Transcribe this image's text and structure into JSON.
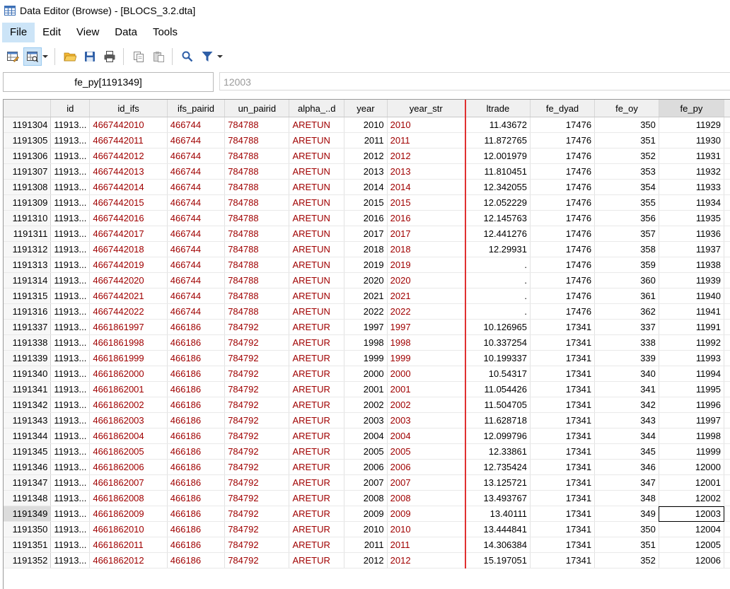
{
  "window": {
    "title": "Data Editor (Browse) - [BLOCS_3.2.dta]"
  },
  "menu": {
    "file": "File",
    "edit": "Edit",
    "view": "View",
    "data": "Data",
    "tools": "Tools"
  },
  "varbar": {
    "name": "fe_py[1191349]",
    "value": "12003"
  },
  "columns": [
    "id",
    "id_ifs",
    "ifs_pairid",
    "un_pairid",
    "alpha_..d",
    "year",
    "year_str",
    "ltrade",
    "fe_dyad",
    "fe_oy",
    "fe_py"
  ],
  "rows": [
    {
      "n": "1191304",
      "id": "11913...",
      "id_ifs": "4667442010",
      "ifs_pairid": "466744",
      "un_pairid": "784788",
      "alpha": "ARETUN",
      "year": "2010",
      "year_str": "2010",
      "ltrade": "11.43672",
      "fe_dyad": "17476",
      "fe_oy": "350",
      "fe_py": "11929"
    },
    {
      "n": "1191305",
      "id": "11913...",
      "id_ifs": "4667442011",
      "ifs_pairid": "466744",
      "un_pairid": "784788",
      "alpha": "ARETUN",
      "year": "2011",
      "year_str": "2011",
      "ltrade": "11.872765",
      "fe_dyad": "17476",
      "fe_oy": "351",
      "fe_py": "11930"
    },
    {
      "n": "1191306",
      "id": "11913...",
      "id_ifs": "4667442012",
      "ifs_pairid": "466744",
      "un_pairid": "784788",
      "alpha": "ARETUN",
      "year": "2012",
      "year_str": "2012",
      "ltrade": "12.001979",
      "fe_dyad": "17476",
      "fe_oy": "352",
      "fe_py": "11931"
    },
    {
      "n": "1191307",
      "id": "11913...",
      "id_ifs": "4667442013",
      "ifs_pairid": "466744",
      "un_pairid": "784788",
      "alpha": "ARETUN",
      "year": "2013",
      "year_str": "2013",
      "ltrade": "11.810451",
      "fe_dyad": "17476",
      "fe_oy": "353",
      "fe_py": "11932"
    },
    {
      "n": "1191308",
      "id": "11913...",
      "id_ifs": "4667442014",
      "ifs_pairid": "466744",
      "un_pairid": "784788",
      "alpha": "ARETUN",
      "year": "2014",
      "year_str": "2014",
      "ltrade": "12.342055",
      "fe_dyad": "17476",
      "fe_oy": "354",
      "fe_py": "11933"
    },
    {
      "n": "1191309",
      "id": "11913...",
      "id_ifs": "4667442015",
      "ifs_pairid": "466744",
      "un_pairid": "784788",
      "alpha": "ARETUN",
      "year": "2015",
      "year_str": "2015",
      "ltrade": "12.052229",
      "fe_dyad": "17476",
      "fe_oy": "355",
      "fe_py": "11934"
    },
    {
      "n": "1191310",
      "id": "11913...",
      "id_ifs": "4667442016",
      "ifs_pairid": "466744",
      "un_pairid": "784788",
      "alpha": "ARETUN",
      "year": "2016",
      "year_str": "2016",
      "ltrade": "12.145763",
      "fe_dyad": "17476",
      "fe_oy": "356",
      "fe_py": "11935"
    },
    {
      "n": "1191311",
      "id": "11913...",
      "id_ifs": "4667442017",
      "ifs_pairid": "466744",
      "un_pairid": "784788",
      "alpha": "ARETUN",
      "year": "2017",
      "year_str": "2017",
      "ltrade": "12.441276",
      "fe_dyad": "17476",
      "fe_oy": "357",
      "fe_py": "11936"
    },
    {
      "n": "1191312",
      "id": "11913...",
      "id_ifs": "4667442018",
      "ifs_pairid": "466744",
      "un_pairid": "784788",
      "alpha": "ARETUN",
      "year": "2018",
      "year_str": "2018",
      "ltrade": "12.29931",
      "fe_dyad": "17476",
      "fe_oy": "358",
      "fe_py": "11937"
    },
    {
      "n": "1191313",
      "id": "11913...",
      "id_ifs": "4667442019",
      "ifs_pairid": "466744",
      "un_pairid": "784788",
      "alpha": "ARETUN",
      "year": "2019",
      "year_str": "2019",
      "ltrade": ".",
      "fe_dyad": "17476",
      "fe_oy": "359",
      "fe_py": "11938"
    },
    {
      "n": "1191314",
      "id": "11913...",
      "id_ifs": "4667442020",
      "ifs_pairid": "466744",
      "un_pairid": "784788",
      "alpha": "ARETUN",
      "year": "2020",
      "year_str": "2020",
      "ltrade": ".",
      "fe_dyad": "17476",
      "fe_oy": "360",
      "fe_py": "11939"
    },
    {
      "n": "1191315",
      "id": "11913...",
      "id_ifs": "4667442021",
      "ifs_pairid": "466744",
      "un_pairid": "784788",
      "alpha": "ARETUN",
      "year": "2021",
      "year_str": "2021",
      "ltrade": ".",
      "fe_dyad": "17476",
      "fe_oy": "361",
      "fe_py": "11940"
    },
    {
      "n": "1191316",
      "id": "11913...",
      "id_ifs": "4667442022",
      "ifs_pairid": "466744",
      "un_pairid": "784788",
      "alpha": "ARETUN",
      "year": "2022",
      "year_str": "2022",
      "ltrade": ".",
      "fe_dyad": "17476",
      "fe_oy": "362",
      "fe_py": "11941"
    },
    {
      "n": "1191337",
      "id": "11913...",
      "id_ifs": "4661861997",
      "ifs_pairid": "466186",
      "un_pairid": "784792",
      "alpha": "ARETUR",
      "year": "1997",
      "year_str": "1997",
      "ltrade": "10.126965",
      "fe_dyad": "17341",
      "fe_oy": "337",
      "fe_py": "11991"
    },
    {
      "n": "1191338",
      "id": "11913...",
      "id_ifs": "4661861998",
      "ifs_pairid": "466186",
      "un_pairid": "784792",
      "alpha": "ARETUR",
      "year": "1998",
      "year_str": "1998",
      "ltrade": "10.337254",
      "fe_dyad": "17341",
      "fe_oy": "338",
      "fe_py": "11992"
    },
    {
      "n": "1191339",
      "id": "11913...",
      "id_ifs": "4661861999",
      "ifs_pairid": "466186",
      "un_pairid": "784792",
      "alpha": "ARETUR",
      "year": "1999",
      "year_str": "1999",
      "ltrade": "10.199337",
      "fe_dyad": "17341",
      "fe_oy": "339",
      "fe_py": "11993"
    },
    {
      "n": "1191340",
      "id": "11913...",
      "id_ifs": "4661862000",
      "ifs_pairid": "466186",
      "un_pairid": "784792",
      "alpha": "ARETUR",
      "year": "2000",
      "year_str": "2000",
      "ltrade": "10.54317",
      "fe_dyad": "17341",
      "fe_oy": "340",
      "fe_py": "11994"
    },
    {
      "n": "1191341",
      "id": "11913...",
      "id_ifs": "4661862001",
      "ifs_pairid": "466186",
      "un_pairid": "784792",
      "alpha": "ARETUR",
      "year": "2001",
      "year_str": "2001",
      "ltrade": "11.054426",
      "fe_dyad": "17341",
      "fe_oy": "341",
      "fe_py": "11995"
    },
    {
      "n": "1191342",
      "id": "11913...",
      "id_ifs": "4661862002",
      "ifs_pairid": "466186",
      "un_pairid": "784792",
      "alpha": "ARETUR",
      "year": "2002",
      "year_str": "2002",
      "ltrade": "11.504705",
      "fe_dyad": "17341",
      "fe_oy": "342",
      "fe_py": "11996"
    },
    {
      "n": "1191343",
      "id": "11913...",
      "id_ifs": "4661862003",
      "ifs_pairid": "466186",
      "un_pairid": "784792",
      "alpha": "ARETUR",
      "year": "2003",
      "year_str": "2003",
      "ltrade": "11.628718",
      "fe_dyad": "17341",
      "fe_oy": "343",
      "fe_py": "11997"
    },
    {
      "n": "1191344",
      "id": "11913...",
      "id_ifs": "4661862004",
      "ifs_pairid": "466186",
      "un_pairid": "784792",
      "alpha": "ARETUR",
      "year": "2004",
      "year_str": "2004",
      "ltrade": "12.099796",
      "fe_dyad": "17341",
      "fe_oy": "344",
      "fe_py": "11998"
    },
    {
      "n": "1191345",
      "id": "11913...",
      "id_ifs": "4661862005",
      "ifs_pairid": "466186",
      "un_pairid": "784792",
      "alpha": "ARETUR",
      "year": "2005",
      "year_str": "2005",
      "ltrade": "12.33861",
      "fe_dyad": "17341",
      "fe_oy": "345",
      "fe_py": "11999"
    },
    {
      "n": "1191346",
      "id": "11913...",
      "id_ifs": "4661862006",
      "ifs_pairid": "466186",
      "un_pairid": "784792",
      "alpha": "ARETUR",
      "year": "2006",
      "year_str": "2006",
      "ltrade": "12.735424",
      "fe_dyad": "17341",
      "fe_oy": "346",
      "fe_py": "12000"
    },
    {
      "n": "1191347",
      "id": "11913...",
      "id_ifs": "4661862007",
      "ifs_pairid": "466186",
      "un_pairid": "784792",
      "alpha": "ARETUR",
      "year": "2007",
      "year_str": "2007",
      "ltrade": "13.125721",
      "fe_dyad": "17341",
      "fe_oy": "347",
      "fe_py": "12001"
    },
    {
      "n": "1191348",
      "id": "11913...",
      "id_ifs": "4661862008",
      "ifs_pairid": "466186",
      "un_pairid": "784792",
      "alpha": "ARETUR",
      "year": "2008",
      "year_str": "2008",
      "ltrade": "13.493767",
      "fe_dyad": "17341",
      "fe_oy": "348",
      "fe_py": "12002"
    },
    {
      "n": "1191349",
      "id": "11913...",
      "id_ifs": "4661862009",
      "ifs_pairid": "466186",
      "un_pairid": "784792",
      "alpha": "ARETUR",
      "year": "2009",
      "year_str": "2009",
      "ltrade": "13.40111",
      "fe_dyad": "17341",
      "fe_oy": "349",
      "fe_py": "12003",
      "selected": true
    },
    {
      "n": "1191350",
      "id": "11913...",
      "id_ifs": "4661862010",
      "ifs_pairid": "466186",
      "un_pairid": "784792",
      "alpha": "ARETUR",
      "year": "2010",
      "year_str": "2010",
      "ltrade": "13.444841",
      "fe_dyad": "17341",
      "fe_oy": "350",
      "fe_py": "12004"
    },
    {
      "n": "1191351",
      "id": "11913...",
      "id_ifs": "4661862011",
      "ifs_pairid": "466186",
      "un_pairid": "784792",
      "alpha": "ARETUR",
      "year": "2011",
      "year_str": "2011",
      "ltrade": "14.306384",
      "fe_dyad": "17341",
      "fe_oy": "351",
      "fe_py": "12005"
    },
    {
      "n": "1191352",
      "id": "11913...",
      "id_ifs": "4661862012",
      "ifs_pairid": "466186",
      "un_pairid": "784792",
      "alpha": "ARETUR",
      "year": "2012",
      "year_str": "2012",
      "ltrade": "15.197051",
      "fe_dyad": "17341",
      "fe_oy": "352",
      "fe_py": "12006"
    }
  ],
  "colors": {
    "string_text": "#a00000",
    "split_line": "#e03030",
    "menu_active": "#cce4f7"
  },
  "icons": [
    "data-editor-icon",
    "edit-mode-icon",
    "browse-mode-icon",
    "open-folder-icon",
    "save-icon",
    "print-icon",
    "copy-icon",
    "paste-icon",
    "find-icon",
    "filter-icon"
  ]
}
